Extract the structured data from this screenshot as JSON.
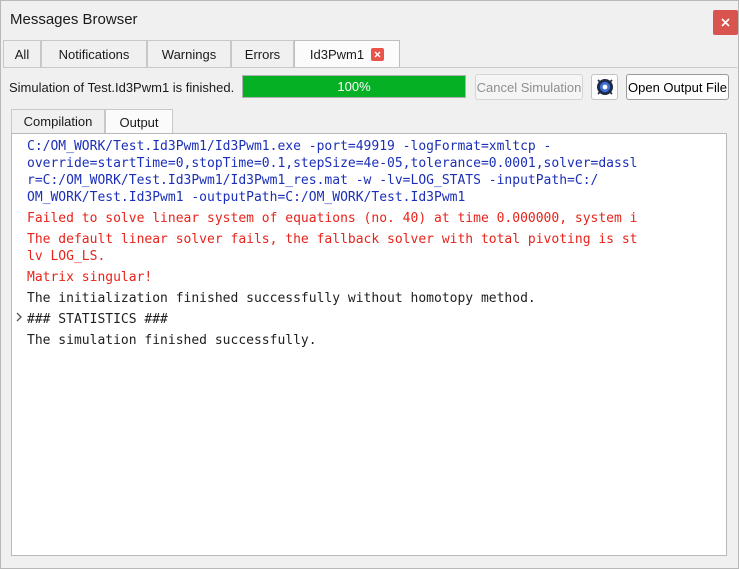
{
  "window": {
    "title": "Messages Browser"
  },
  "tabs": [
    {
      "label": "All"
    },
    {
      "label": "Notifications"
    },
    {
      "label": "Warnings"
    },
    {
      "label": "Errors"
    },
    {
      "label": "Id3Pwm1"
    }
  ],
  "status": {
    "label": "Simulation of Test.Id3Pwm1 is finished.",
    "progress_text": "100%",
    "progress_value": 1.0,
    "progress_color": "#06b025"
  },
  "buttons": {
    "cancel": "Cancel Simulation",
    "open_output": "Open Output File",
    "interactive_icon": "simulation-debug-icon"
  },
  "subtabs": [
    {
      "label": "Compilation"
    },
    {
      "label": "Output"
    }
  ],
  "output": {
    "command_lines": [
      "C:/OM_WORK/Test.Id3Pwm1/Id3Pwm1.exe -port=49919 -logFormat=xmltcp -",
      "override=startTime=0,stopTime=0.1,stepSize=4e-05,tolerance=0.0001,solver=dassl",
      "r=C:/OM_WORK/Test.Id3Pwm1/Id3Pwm1_res.mat -w -lv=LOG_STATS -inputPath=C:/",
      "OM_WORK/Test.Id3Pwm1 -outputPath=C:/OM_WORK/Test.Id3Pwm1"
    ],
    "error_line_1": "Failed to solve linear system of equations (no. 40) at time 0.000000, system i",
    "error_line_2a": "The default linear solver fails, the fallback solver with total pivoting is st",
    "error_line_2b": "lv LOG_LS.",
    "error_line_3": "Matrix singular!",
    "info_line_1": "The initialization finished successfully without homotopy method.",
    "stats_line": "### STATISTICS ###",
    "info_line_2": "The simulation finished successfully."
  }
}
